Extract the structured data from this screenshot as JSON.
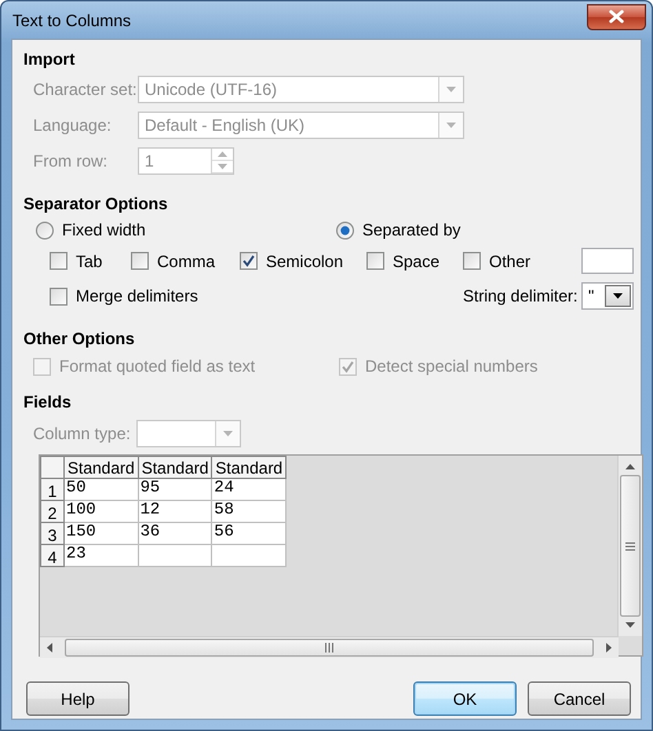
{
  "window": {
    "title": "Text to Columns"
  },
  "import": {
    "heading": "Import",
    "fields": [
      {
        "label": "Character set:",
        "kind": "combo",
        "value": "Unicode (UTF-16)",
        "disabled": true
      },
      {
        "label": "Language:",
        "kind": "combo",
        "value": "Default - English (UK)",
        "disabled": true
      },
      {
        "label": "From row:",
        "kind": "spin",
        "value": "1",
        "disabled": true
      }
    ]
  },
  "separator_options": {
    "heading": "Separator Options",
    "modes": [
      {
        "label": "Fixed width",
        "selected": false
      },
      {
        "label": "Separated by",
        "selected": true
      }
    ],
    "separators": [
      {
        "label": "Tab",
        "checked": false
      },
      {
        "label": "Comma",
        "checked": false
      },
      {
        "label": "Semicolon",
        "checked": true
      },
      {
        "label": "Space",
        "checked": false
      },
      {
        "label": "Other",
        "checked": false
      }
    ],
    "merge_delimiters": {
      "label": "Merge delimiters",
      "checked": false
    },
    "string_delimiter": {
      "label": "String delimiter:",
      "value": "\""
    }
  },
  "other_options": {
    "heading": "Other Options",
    "options": [
      {
        "label": "Format quoted field as text",
        "checked": false,
        "disabled": true
      },
      {
        "label": "Detect special numbers",
        "checked": true,
        "disabled": true
      }
    ]
  },
  "fields": {
    "heading": "Fields",
    "column_type": {
      "label": "Column type:",
      "disabled": true
    },
    "columns": [
      "Standard",
      "Standard",
      "Standard"
    ],
    "rows": [
      {
        "number": "1",
        "cells": [
          "50",
          "95",
          "24"
        ]
      },
      {
        "number": "2",
        "cells": [
          "100",
          "12",
          "58"
        ]
      },
      {
        "number": "3",
        "cells": [
          "150",
          "36",
          "56"
        ]
      },
      {
        "number": "4",
        "cells": [
          "23"
        ]
      }
    ]
  },
  "buttons": [
    {
      "label": "Help",
      "default": false
    },
    {
      "label": "OK",
      "default": true
    },
    {
      "label": "Cancel",
      "default": false
    }
  ]
}
